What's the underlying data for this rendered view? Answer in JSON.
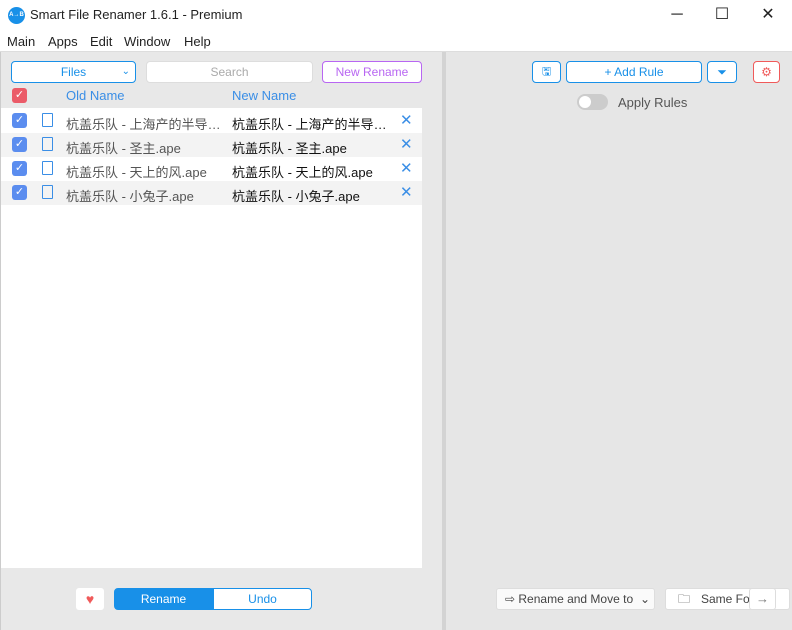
{
  "window": {
    "title": "Smart File Renamer 1.6.1 - Premium",
    "logo": "A→B",
    "minimize": "─",
    "maximize": "☐",
    "close": "✕"
  },
  "menu": [
    "Main",
    "Apps",
    "Edit",
    "Window",
    "Help"
  ],
  "left": {
    "files_select": "Files",
    "search_placeholder": "Search",
    "new_rename": "New Rename",
    "columns": {
      "old": "Old Name",
      "new": "New Name"
    },
    "rows": [
      {
        "old": "杭盖乐队 - 上海产的半导体.ape",
        "new": "杭盖乐队 - 上海产的半导体.ape",
        "checked": true
      },
      {
        "old": "杭盖乐队 - 圣主.ape",
        "new": "杭盖乐队 - 圣主.ape",
        "checked": true
      },
      {
        "old": "杭盖乐队 - 天上的风.ape",
        "new": "杭盖乐队 - 天上的风.ape",
        "checked": true
      },
      {
        "old": "杭盖乐队 - 小兔子.ape",
        "new": "杭盖乐队 - 小兔子.ape",
        "checked": true
      }
    ],
    "rename": "Rename",
    "undo": "Undo"
  },
  "right": {
    "add_rule": "+ Add Rule",
    "apply_rules": "Apply Rules",
    "apply_rules_on": false,
    "rename_mode": "⇨ Rename and Move to",
    "folder": "Same Fo",
    "arrow": "→"
  },
  "colors": {
    "accent": "#1890e8",
    "purple": "#b866f2",
    "red": "#f05a5a"
  }
}
